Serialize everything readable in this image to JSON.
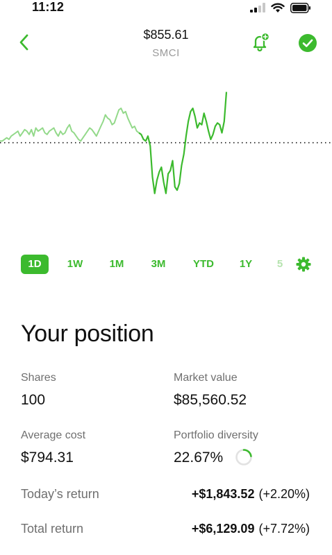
{
  "status": {
    "time": "11:12"
  },
  "header": {
    "price": "$855.61",
    "ticker": "SMCI"
  },
  "colors": {
    "accent": "#3cba2e",
    "chart_muted": "#93d98a",
    "text": "#111111",
    "label": "#6f6f6f"
  },
  "icons": {
    "back": "chevron-left-icon",
    "bell": "bell-plus-icon",
    "check": "check-circle-icon",
    "gear": "gear-icon"
  },
  "ranges": [
    "1D",
    "1W",
    "1M",
    "3M",
    "YTD",
    "1Y",
    "5"
  ],
  "active_range": "1D",
  "chart_data": {
    "type": "line",
    "series": [
      {
        "values": [
          52,
          52,
          53,
          54,
          53,
          55,
          56,
          57,
          58,
          55,
          57,
          59,
          58,
          56,
          59,
          55,
          60,
          58,
          59,
          60,
          57,
          56,
          58,
          59,
          60,
          57,
          55,
          58,
          56,
          57,
          60,
          62,
          58,
          57,
          55,
          53,
          52,
          54,
          56,
          58,
          60,
          59,
          57,
          55,
          58,
          61,
          64,
          68,
          66,
          65,
          62,
          63,
          67,
          71,
          72,
          69,
          70,
          66,
          63,
          60,
          61,
          58,
          57,
          56,
          53,
          52,
          55,
          49,
          30,
          20,
          28,
          33,
          36,
          27,
          20,
          32,
          34,
          40,
          24,
          22,
          26,
          37,
          44,
          55,
          64,
          70,
          72,
          67,
          60,
          63,
          62,
          69,
          64,
          58,
          53,
          56,
          61,
          63,
          62,
          57,
          64,
          82
        ]
      }
    ],
    "baseline": 51
  },
  "position": {
    "title": "Your position",
    "shares_label": "Shares",
    "shares_value": "100",
    "market_value_label": "Market value",
    "market_value_value": "$85,560.52",
    "avg_cost_label": "Average cost",
    "avg_cost_value": "$794.31",
    "diversity_label": "Portfolio diversity",
    "diversity_value": "22.67%",
    "diversity_fraction": 0.2267,
    "today_label": "Today’s return",
    "today_amount": "+$1,843.52",
    "today_pct": "(+2.20%)",
    "total_label": "Total return",
    "total_amount": "+$6,129.09",
    "total_pct": "(+7.72%)"
  }
}
